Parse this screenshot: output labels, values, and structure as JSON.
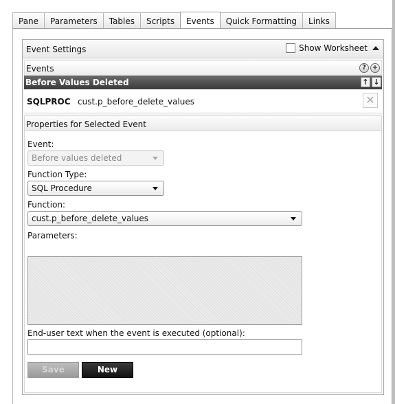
{
  "tabs": [
    {
      "label": "Pane",
      "active": false
    },
    {
      "label": "Parameters",
      "active": false
    },
    {
      "label": "Tables",
      "active": false
    },
    {
      "label": "Scripts",
      "active": false
    },
    {
      "label": "Events",
      "active": true
    },
    {
      "label": "Quick Formatting",
      "active": false
    },
    {
      "label": "Links",
      "active": false
    }
  ],
  "event_settings": {
    "title": "Event Settings",
    "show_worksheet_label": "Show Worksheet",
    "show_worksheet_checked": false
  },
  "events": {
    "title": "Events",
    "help_icon": "?",
    "add_icon": "+",
    "selected_header": "Before Values Deleted",
    "move_up_icon": "↑",
    "move_down_icon": "↓",
    "row": {
      "code": "SQLPROC",
      "function": "cust.p_before_delete_values",
      "delete_icon": "✕"
    }
  },
  "properties": {
    "title": "Properties for Selected Event",
    "event_label": "Event:",
    "event_value": "Before values deleted",
    "function_type_label": "Function Type:",
    "function_type_value": "SQL Procedure",
    "function_label": "Function:",
    "function_value": "cust.p_before_delete_values",
    "parameters_label": "Parameters:",
    "enduser_label": "End-user text when the event is executed (optional):",
    "enduser_value": "",
    "save_label": "Save",
    "new_label": "New"
  }
}
